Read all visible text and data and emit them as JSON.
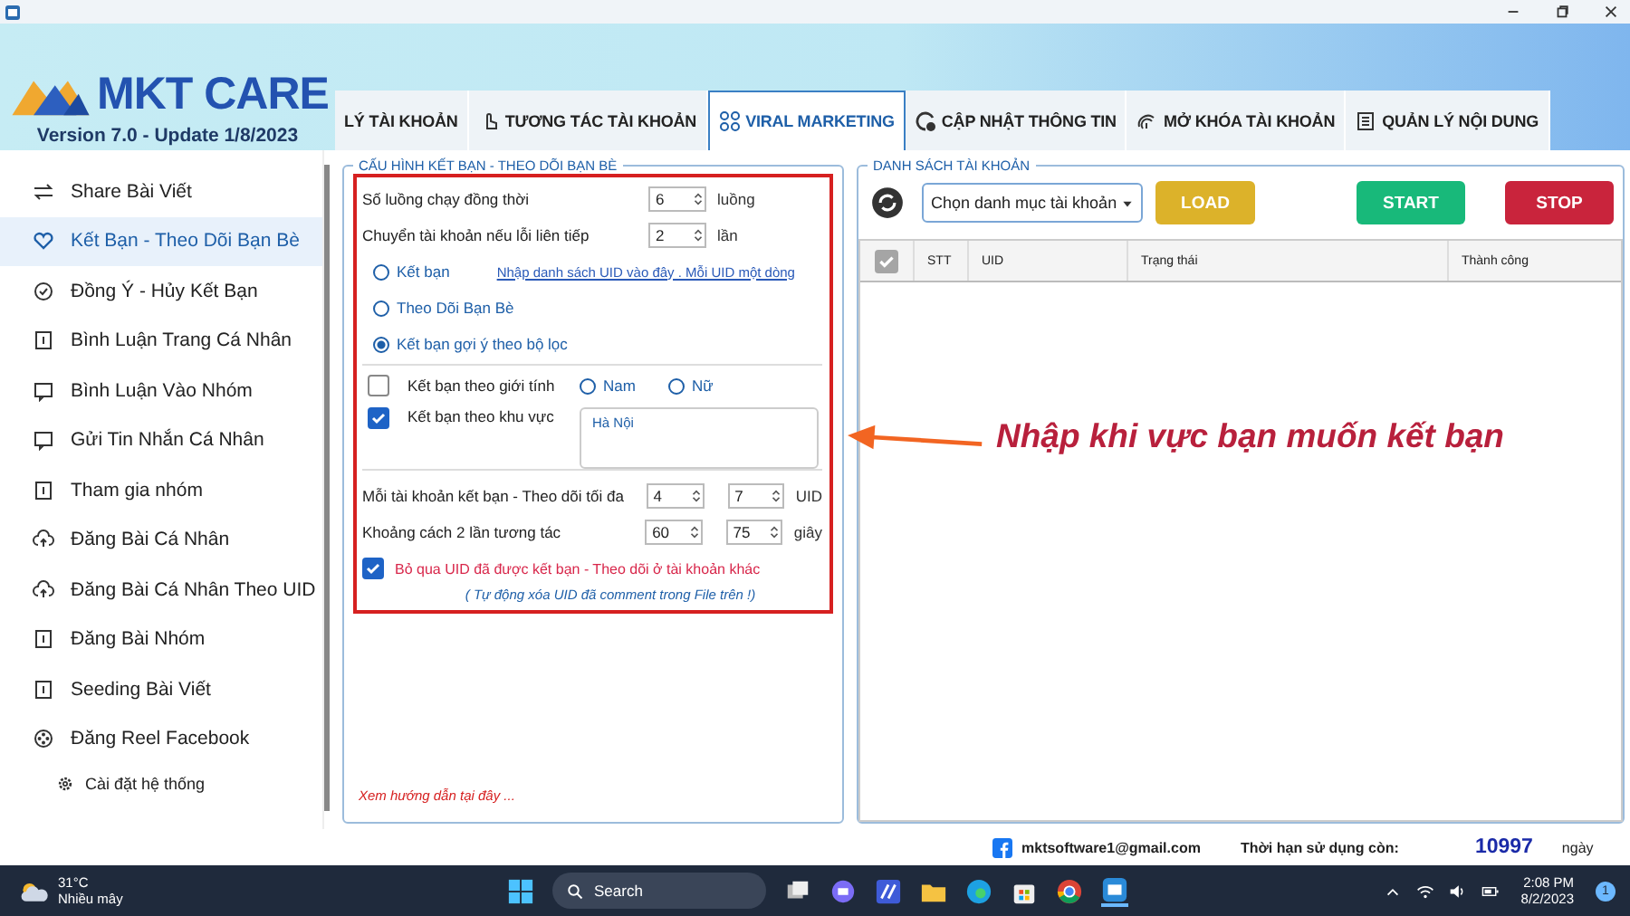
{
  "brand": {
    "name": "MKT CARE",
    "version": "Version  7.0  - Update  1/8/2023"
  },
  "tabs": [
    {
      "label": "LÝ TÀI KHOẢN",
      "selected": false
    },
    {
      "label": "TƯƠNG TÁC TÀI KHOẢN",
      "selected": false
    },
    {
      "label": "VIRAL MARKETING",
      "selected": true
    },
    {
      "label": "CẬP NHẬT THÔNG TIN",
      "selected": false
    },
    {
      "label": "MỞ KHÓA TÀI KHOẢN",
      "selected": false
    },
    {
      "label": "QUẢN LÝ NỘI DUNG",
      "selected": false
    }
  ],
  "sidebar": {
    "items": [
      {
        "label": "Share Bài Viết",
        "selected": false,
        "kind": "main"
      },
      {
        "label": "Kết Bạn - Theo Dõi Bạn Bè",
        "selected": true,
        "kind": "main"
      },
      {
        "label": "Đồng Ý - Hủy Kết Bạn",
        "selected": false,
        "kind": "main"
      },
      {
        "label": "Bình Luận Trang Cá Nhân",
        "selected": false,
        "kind": "main"
      },
      {
        "label": "Bình Luận Vào Nhóm",
        "selected": false,
        "kind": "main"
      },
      {
        "label": "Gửi Tin Nhắn Cá Nhân",
        "selected": false,
        "kind": "main"
      },
      {
        "label": "Tham gia nhóm",
        "selected": false,
        "kind": "main"
      },
      {
        "label": "Đăng Bài Cá Nhân",
        "selected": false,
        "kind": "main"
      },
      {
        "label": "Đăng Bài Cá Nhân Theo UID",
        "selected": false,
        "kind": "main"
      },
      {
        "label": "Đăng Bài Nhóm",
        "selected": false,
        "kind": "main"
      },
      {
        "label": "Seeding Bài Viết",
        "selected": false,
        "kind": "main"
      },
      {
        "label": "Đăng Reel Facebook",
        "selected": false,
        "kind": "main"
      },
      {
        "label": "Cài đặt hệ thống",
        "selected": false,
        "kind": "sub"
      }
    ]
  },
  "config": {
    "title": "CẤU HÌNH KẾT BẠN - THEO DÕI BẠN BÈ",
    "threads": {
      "label": "Số luồng chạy đồng thời",
      "value": "6",
      "unit": "luồng"
    },
    "switch_on_error": {
      "label": "Chuyển tài khoản nếu lỗi liên tiếp",
      "value": "2",
      "unit": "lần"
    },
    "modes": [
      {
        "label": "Kết bạn",
        "selected": false
      },
      {
        "label": "Theo Dõi Bạn Bè",
        "selected": false
      },
      {
        "label": "Kết bạn gợi ý theo bộ lọc",
        "selected": true
      }
    ],
    "uid_link": "Nhập danh sách UID vào đây . Mỗi UID một dòng",
    "gender_filter": {
      "label": "Kết bạn theo giới tính",
      "checked": false,
      "options": [
        {
          "label": "Nam",
          "selected": false
        },
        {
          "label": "Nữ",
          "selected": false
        }
      ]
    },
    "region_filter": {
      "label": "Kết bạn theo khu vực",
      "checked": true,
      "value": "Hà Nội"
    },
    "max_per_account": {
      "label": "Mỗi tài khoản kết bạn - Theo dõi tối đa",
      "from": "4",
      "to": "7",
      "unit": "UID"
    },
    "delay": {
      "label": "Khoảng cách 2 lần tương tác",
      "from": "60",
      "to": "75",
      "unit": "giây"
    },
    "skip_followed": {
      "label": "Bỏ qua UID đã được kết bạn - Theo dõi ở tài khoản khác",
      "checked": true,
      "note": "( Tự động xóa UID đã comment trong File trên !)"
    },
    "guide_link": "Xem hướng dẫn tại đây ..."
  },
  "accounts": {
    "title": "DANH SÁCH TÀI KHOẢN",
    "category": "Chọn danh mục tài khoản",
    "buttons": [
      {
        "label": "LOAD",
        "kind": "load"
      },
      {
        "label": "START",
        "kind": "start"
      },
      {
        "label": "STOP",
        "kind": "stop"
      }
    ],
    "select_all": {
      "checked": true
    },
    "columns": [
      "STT",
      "UID",
      "Trạng thái",
      "Thành công"
    ]
  },
  "annotation": "Nhập khi vực bạn muốn kết bạn",
  "status_bar": {
    "email": "mktsoftware1@gmail.com",
    "license_label": "Thời hạn sử dụng còn:",
    "days": "10997",
    "days_unit": "ngày"
  },
  "taskbar": {
    "temperature": "31°C",
    "weather": "Nhiều mây",
    "search": "Search",
    "time": "2:08 PM",
    "date": "8/2/2023",
    "notifications": "1"
  }
}
